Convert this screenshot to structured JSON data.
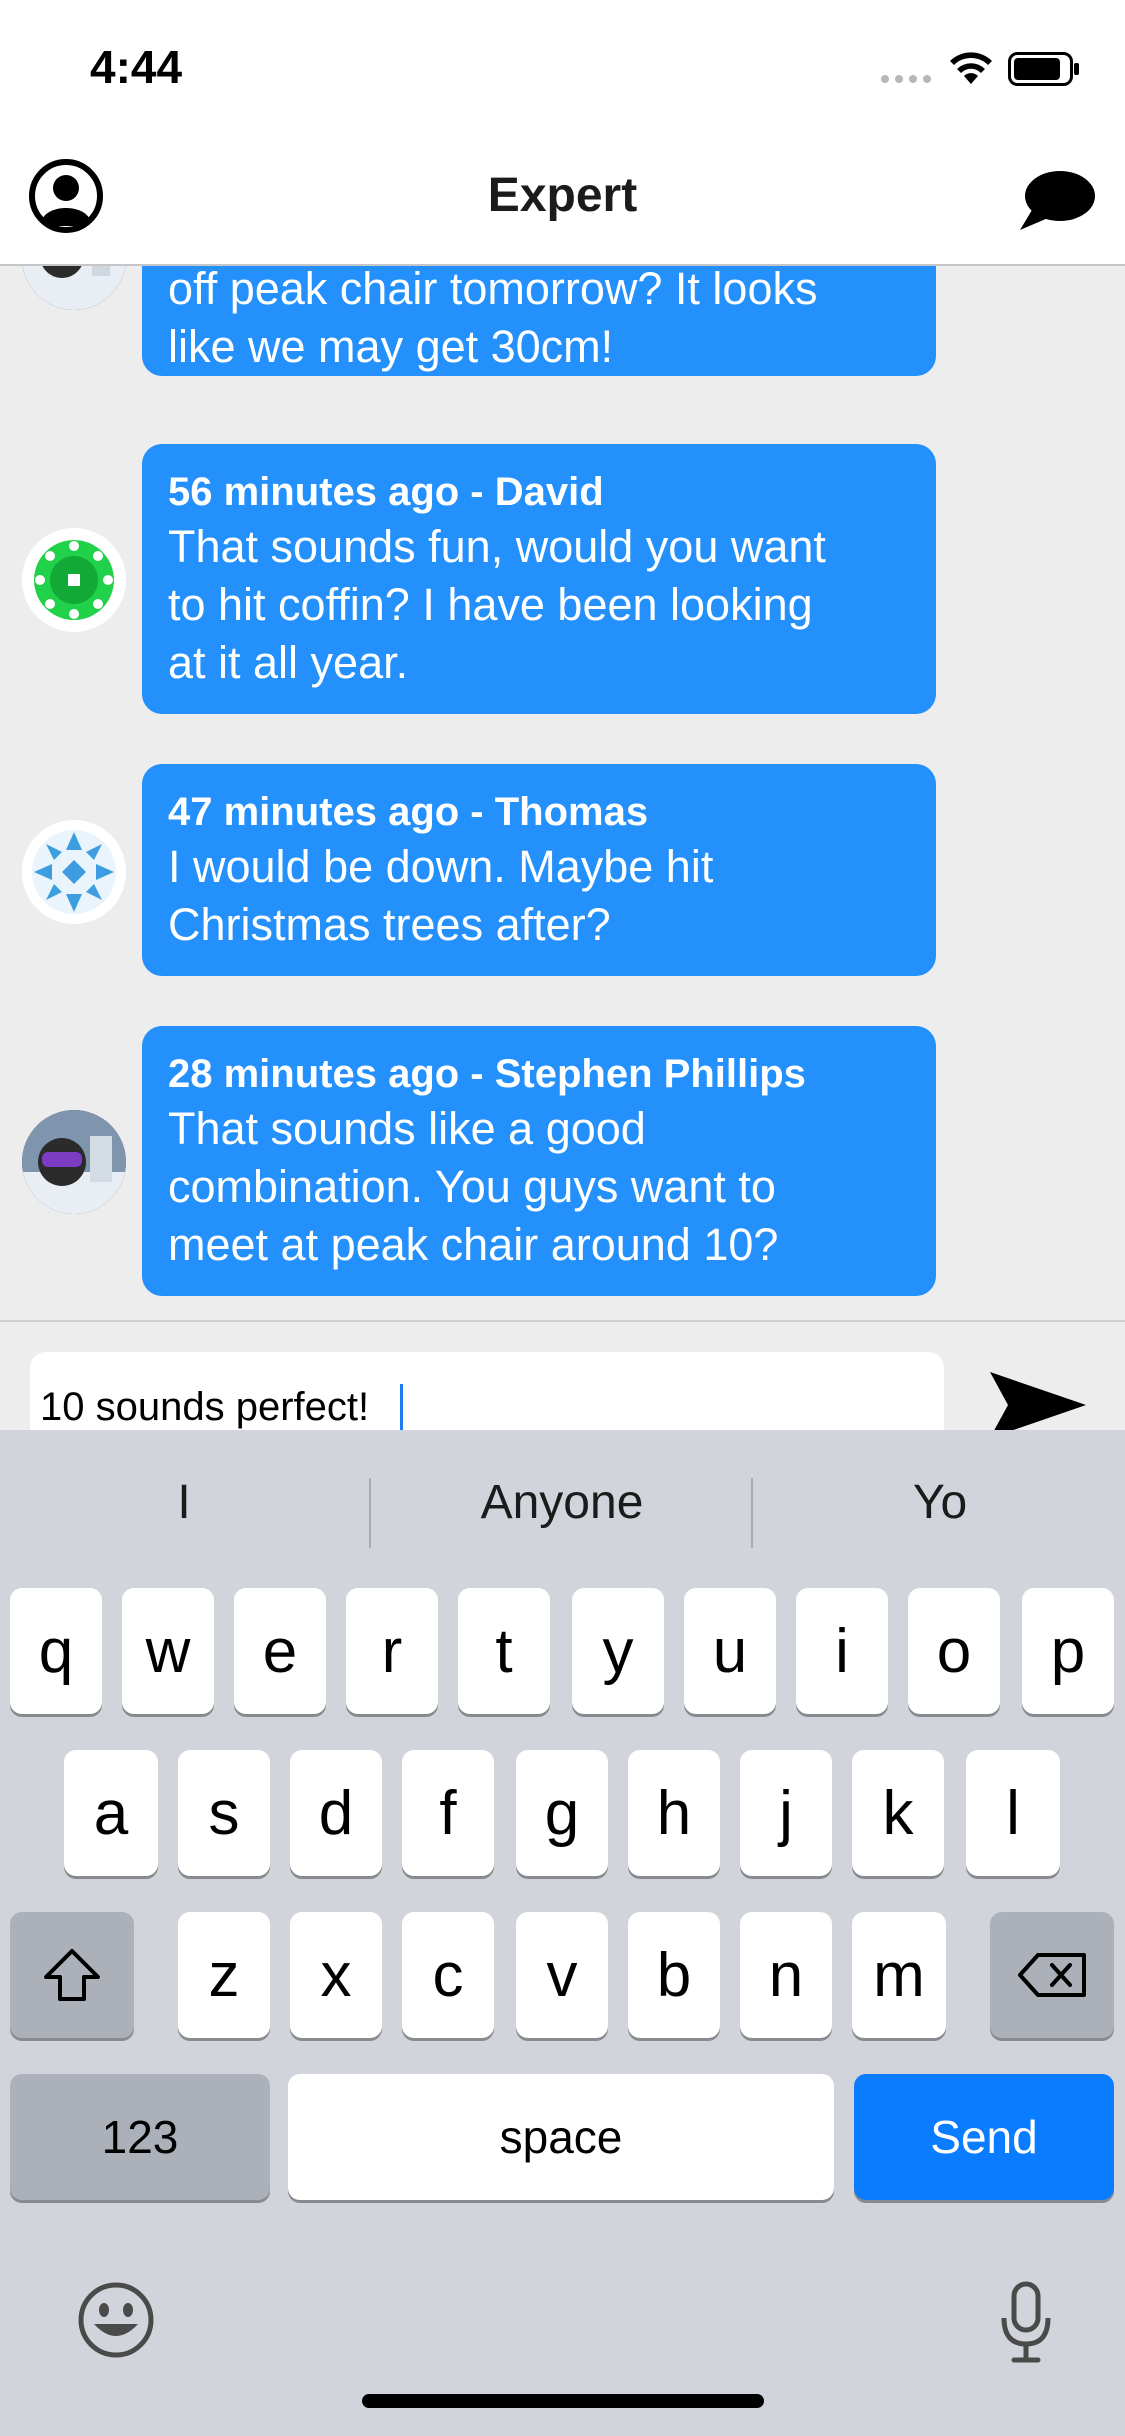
{
  "status_bar": {
    "time": "4:44"
  },
  "nav": {
    "title": "Expert"
  },
  "messages": [
    {
      "meta": "",
      "text": "off peak chair tomorrow?  It looks\nlike we may get 30cm!",
      "avatar": "photo-avatar"
    },
    {
      "meta": "56 minutes ago - David",
      "text": "That sounds fun, would you want\nto hit coffin?  I have been looking\nat it all year.",
      "avatar": "green-pattern-avatar"
    },
    {
      "meta": "47 minutes ago - Thomas",
      "text": "I would be down.  Maybe hit\nChristmas trees after?",
      "avatar": "blue-pattern-avatar"
    },
    {
      "meta": "28 minutes ago - Stephen Phillips",
      "text": "That sounds like a good\ncombination.  You guys want to\nmeet at peak chair around 10?",
      "avatar": "photo-avatar"
    }
  ],
  "composer": {
    "value": "10 sounds perfect!"
  },
  "keyboard": {
    "suggestions": [
      "I",
      "Anyone",
      "Yo"
    ],
    "row1": [
      "q",
      "w",
      "e",
      "r",
      "t",
      "y",
      "u",
      "i",
      "o",
      "p"
    ],
    "row2": [
      "a",
      "s",
      "d",
      "f",
      "g",
      "h",
      "j",
      "k",
      "l"
    ],
    "row3": [
      "z",
      "x",
      "c",
      "v",
      "b",
      "n",
      "m"
    ],
    "numbers_label": "123",
    "space_label": "space",
    "send_label": "Send"
  },
  "colors": {
    "bubble": "#2390fb",
    "send_key": "#0a7cff",
    "background": "#ededed"
  }
}
